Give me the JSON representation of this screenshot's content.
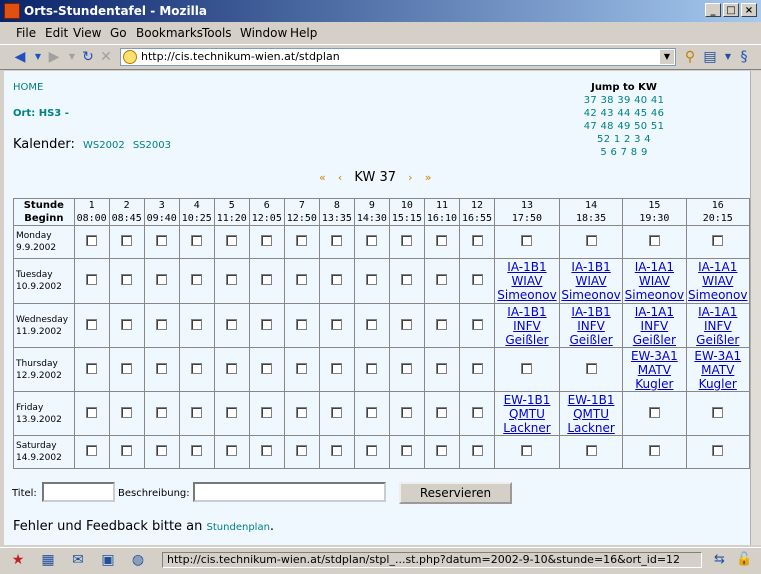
{
  "window": {
    "title": "Orts-Stundentafel - Mozilla"
  },
  "menu": [
    "File",
    "Edit",
    "View",
    "Go",
    "Bookmarks",
    "Tools",
    "Window",
    "Help"
  ],
  "address": {
    "url": "http://cis.technikum-wien.at/stdplan"
  },
  "page": {
    "home_link": "HOME",
    "ort_label": "Ort: HS3 -",
    "kalender_label": "Kalender:",
    "ws_link": "WS2002",
    "ss_link": "SS2003",
    "jump_title": "Jump to KW",
    "jump_lines": [
      "37 38 39 40 41",
      "42 43 44 45 46",
      "47 48 49 50 51",
      "52 1 2 3 4",
      "5 6 7 8 9"
    ],
    "kw_prev_far": "«",
    "kw_prev": "‹",
    "kw_label": "KW 37",
    "kw_next": "›",
    "kw_next_far": "»"
  },
  "table": {
    "corner": [
      "Stunde",
      "Beginn"
    ],
    "hours": [
      {
        "n": "1",
        "t": "08:00"
      },
      {
        "n": "2",
        "t": "08:45"
      },
      {
        "n": "3",
        "t": "09:40"
      },
      {
        "n": "4",
        "t": "10:25"
      },
      {
        "n": "5",
        "t": "11:20"
      },
      {
        "n": "6",
        "t": "12:05"
      },
      {
        "n": "7",
        "t": "12:50"
      },
      {
        "n": "8",
        "t": "13:35"
      },
      {
        "n": "9",
        "t": "14:30"
      },
      {
        "n": "10",
        "t": "15:15"
      },
      {
        "n": "11",
        "t": "16:10"
      },
      {
        "n": "12",
        "t": "16:55"
      },
      {
        "n": "13",
        "t": "17:50"
      },
      {
        "n": "14",
        "t": "18:35"
      },
      {
        "n": "15",
        "t": "19:30"
      },
      {
        "n": "16",
        "t": "20:15"
      }
    ],
    "days": [
      {
        "name": "Monday",
        "date": "9.9.2002",
        "entries": {}
      },
      {
        "name": "Tuesday",
        "date": "10.9.2002",
        "entries": {
          "12": [
            "IA-1B1",
            "WIAV",
            "Simeonov"
          ],
          "13": [
            "IA-1B1",
            "WIAV",
            "Simeonov"
          ],
          "14": [
            "IA-1A1",
            "WIAV",
            "Simeonov"
          ],
          "15": [
            "IA-1A1",
            "WIAV",
            "Simeonov"
          ]
        }
      },
      {
        "name": "Wednesday",
        "date": "11.9.2002",
        "entries": {
          "12": [
            "IA-1B1",
            "INFV",
            "Geißler"
          ],
          "13": [
            "IA-1B1",
            "INFV",
            "Geißler"
          ],
          "14": [
            "IA-1A1",
            "INFV",
            "Geißler"
          ],
          "15": [
            "IA-1A1",
            "INFV",
            "Geißler"
          ]
        }
      },
      {
        "name": "Thursday",
        "date": "12.9.2002",
        "entries": {
          "14": [
            "EW-3A1",
            "MATV",
            "Kugler"
          ],
          "15": [
            "EW-3A1",
            "MATV",
            "Kugler"
          ]
        }
      },
      {
        "name": "Friday",
        "date": "13.9.2002",
        "entries": {
          "12": [
            "EW-1B1",
            "QMTU",
            "Lackner"
          ],
          "13": [
            "EW-1B1",
            "QMTU",
            "Lackner"
          ]
        }
      },
      {
        "name": "Saturday",
        "date": "14.9.2002",
        "entries": {}
      }
    ]
  },
  "form": {
    "titel_label": "Titel:",
    "beschreibung_label": "Beschreibung:",
    "titel_value": "",
    "beschreibung_value": "",
    "submit_label": "Reservieren"
  },
  "feedback": {
    "text": "Fehler und Feedback bitte an",
    "link": "Stundenplan",
    "suffix": "."
  },
  "status": {
    "text": "http://cis.technikum-wien.at/stdplan/stpl_...st.php?datum=2002-9-10&stunde=16&ort_id=12"
  }
}
